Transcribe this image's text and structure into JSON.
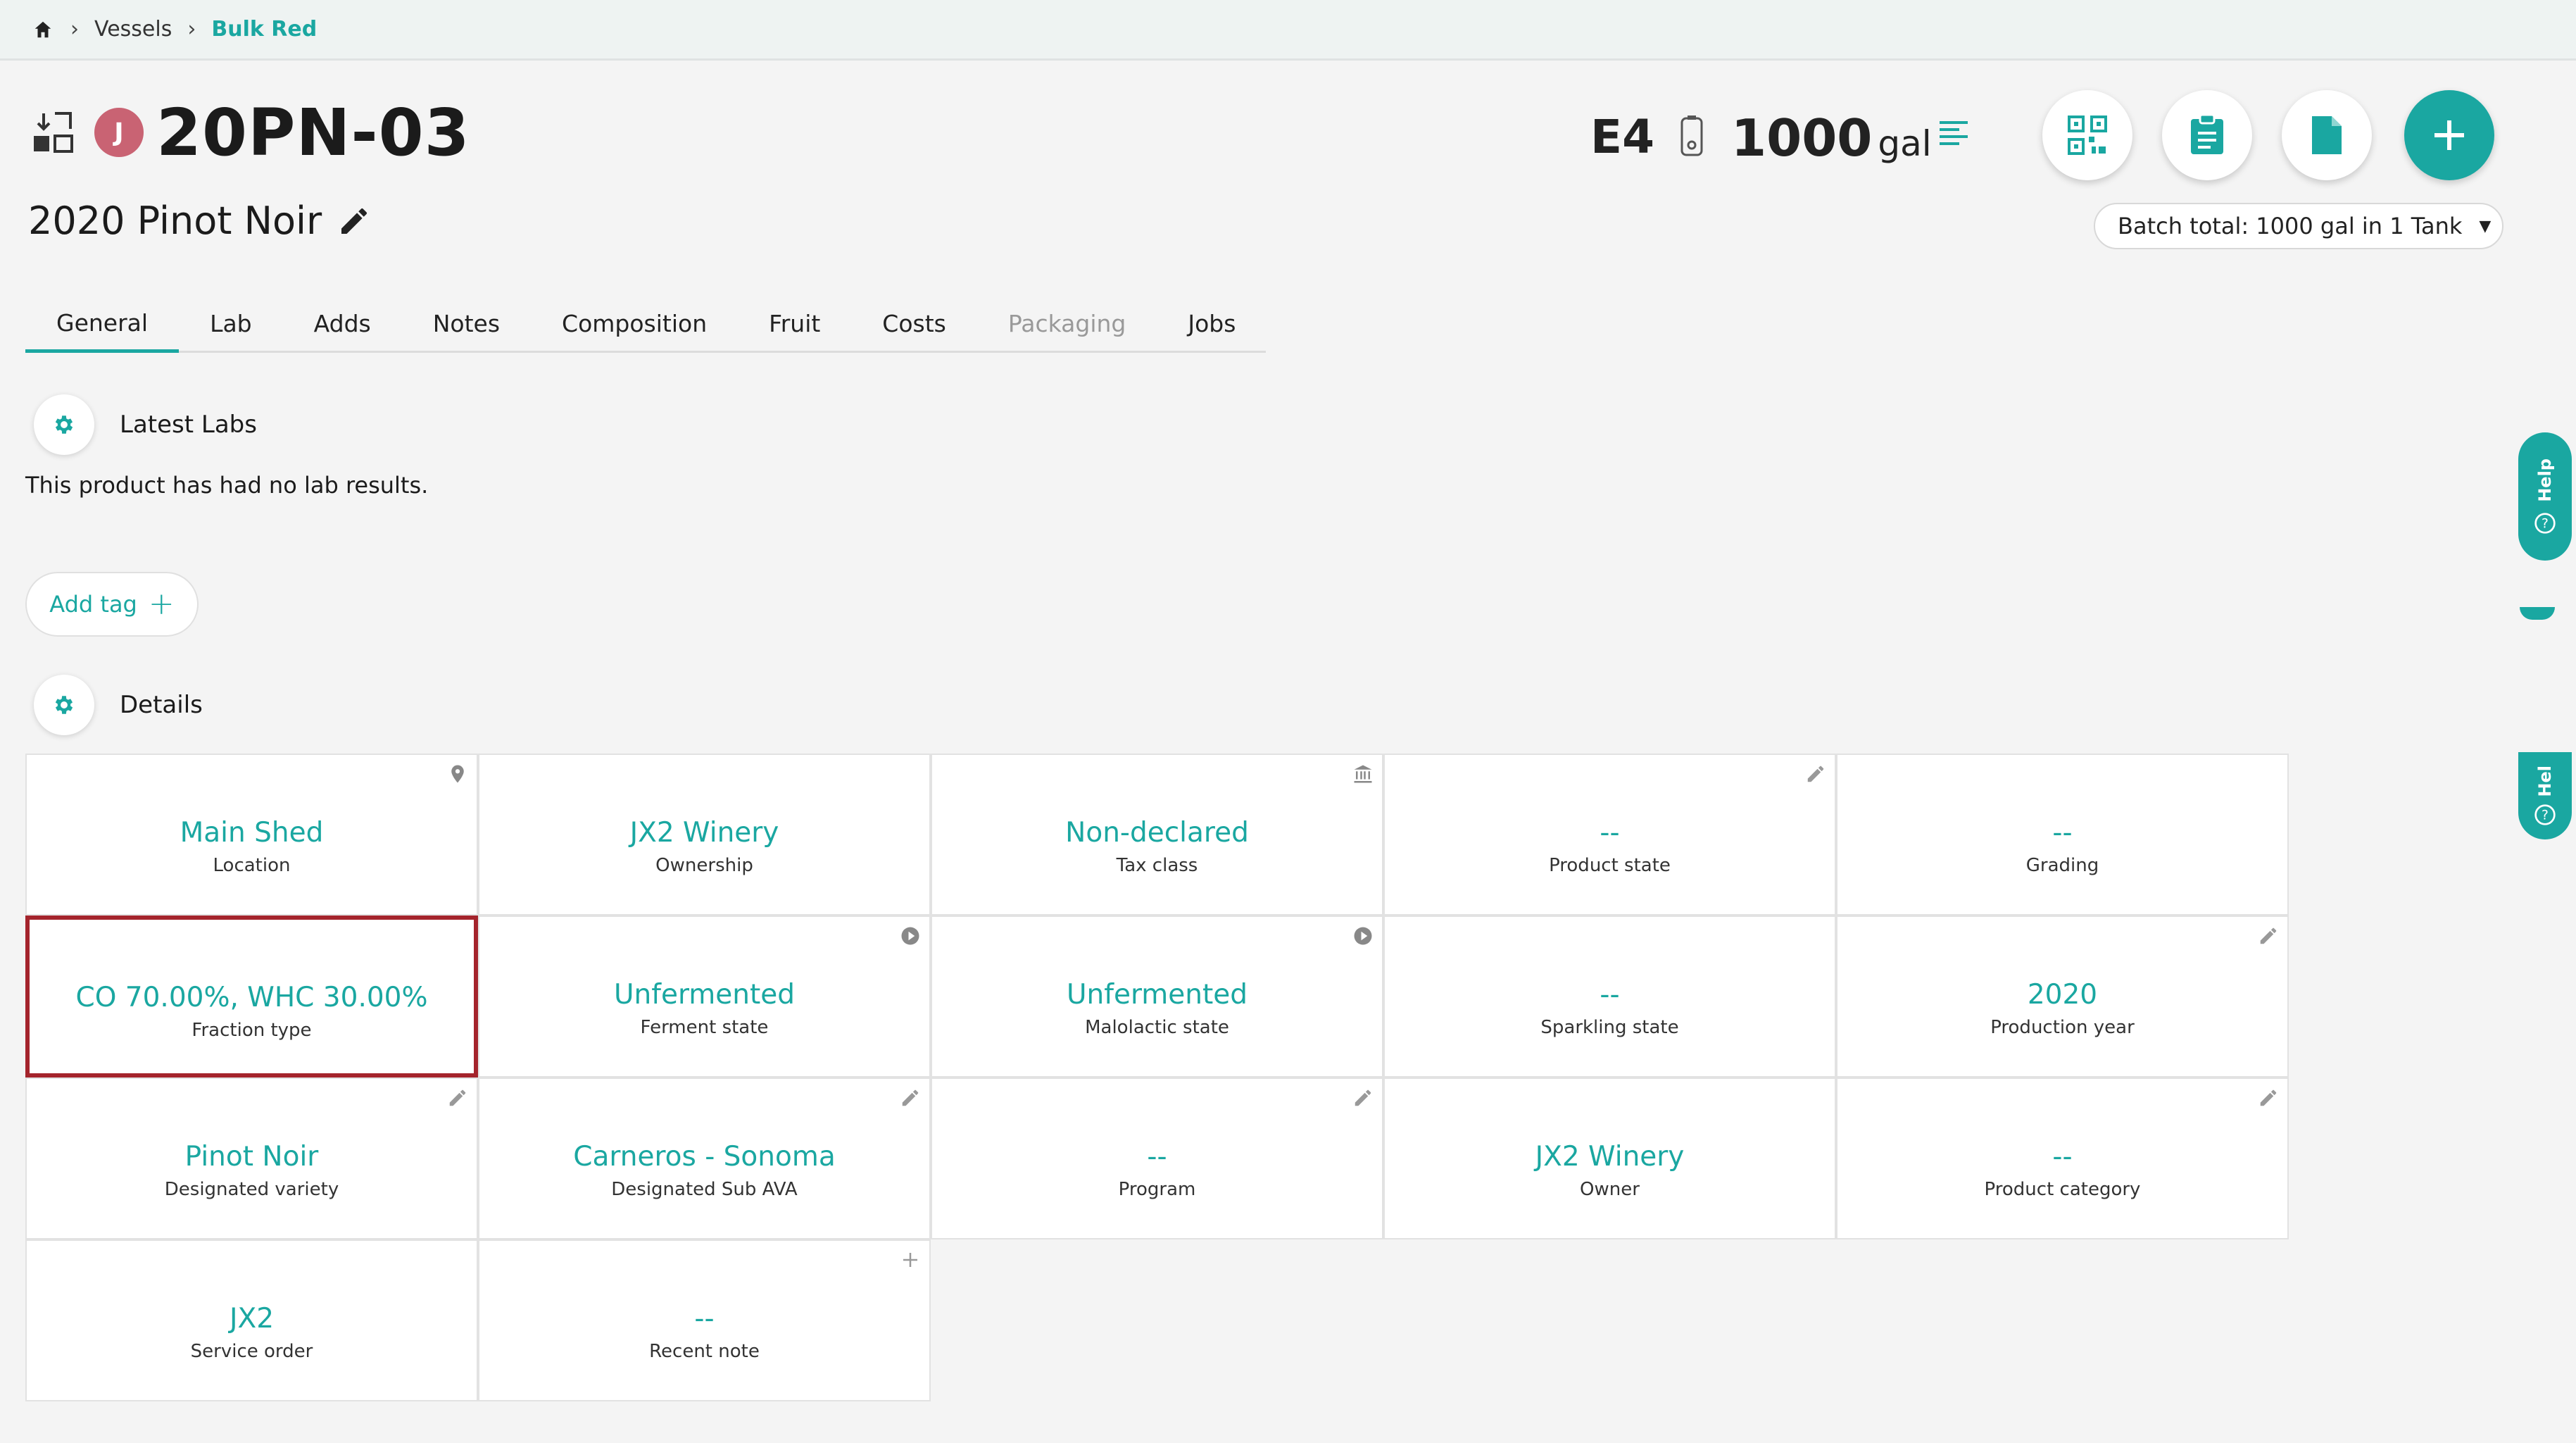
{
  "breadcrumb": {
    "items": [
      "Vessels",
      "Bulk Red"
    ]
  },
  "vessel": {
    "avatar_letter": "J",
    "title": "20PN-03",
    "subtitle": "2020 Pinot Noir"
  },
  "header_right": {
    "code": "E4",
    "volume": "1000",
    "unit": "gal",
    "batch_total": "Batch total: 1000 gal in 1 Tank"
  },
  "tabs": [
    {
      "label": "General",
      "state": "active"
    },
    {
      "label": "Lab",
      "state": "normal"
    },
    {
      "label": "Adds",
      "state": "normal"
    },
    {
      "label": "Notes",
      "state": "normal"
    },
    {
      "label": "Composition",
      "state": "normal"
    },
    {
      "label": "Fruit",
      "state": "normal"
    },
    {
      "label": "Costs",
      "state": "normal"
    },
    {
      "label": "Packaging",
      "state": "disabled"
    },
    {
      "label": "Jobs",
      "state": "normal"
    }
  ],
  "latest_labs": {
    "title": "Latest Labs",
    "empty_text": "This product has had no lab results."
  },
  "add_tag": {
    "label": "Add tag"
  },
  "details": {
    "title": "Details",
    "cells": [
      {
        "value": "Main Shed",
        "label": "Location",
        "icon": "map-pin-icon"
      },
      {
        "value": "JX2 Winery",
        "label": "Ownership",
        "icon": ""
      },
      {
        "value": "Non-declared",
        "label": "Tax class",
        "icon": "bank-icon"
      },
      {
        "value": "--",
        "label": "Product state",
        "icon": "pencil-icon"
      },
      {
        "value": "--",
        "label": "Grading",
        "icon": ""
      },
      {
        "value": "CO 70.00%, WHC 30.00%",
        "label": "Fraction type",
        "icon": "",
        "selected": true
      },
      {
        "value": "Unfermented",
        "label": "Ferment state",
        "icon": "play-icon"
      },
      {
        "value": "Unfermented",
        "label": "Malolactic state",
        "icon": "play-icon"
      },
      {
        "value": "--",
        "label": "Sparkling state",
        "icon": ""
      },
      {
        "value": "2020",
        "label": "Production year",
        "icon": "pencil-icon"
      },
      {
        "value": "Pinot Noir",
        "label": "Designated variety",
        "icon": "pencil-icon"
      },
      {
        "value": "Carneros - Sonoma",
        "label": "Designated Sub AVA",
        "icon": "pencil-icon"
      },
      {
        "value": "--",
        "label": "Program",
        "icon": "pencil-icon"
      },
      {
        "value": "JX2 Winery",
        "label": "Owner",
        "icon": ""
      },
      {
        "value": "--",
        "label": "Product category",
        "icon": "pencil-icon"
      },
      {
        "value": "JX2",
        "label": "Service order",
        "icon": ""
      },
      {
        "value": "--",
        "label": "Recent note",
        "icon": "plus-icon"
      }
    ]
  },
  "help": {
    "label": "Help",
    "label_partial": "Hel"
  },
  "colors": {
    "accent": "#1aa7a1",
    "avatar": "#c96373",
    "selected_border": "#a4242c"
  }
}
